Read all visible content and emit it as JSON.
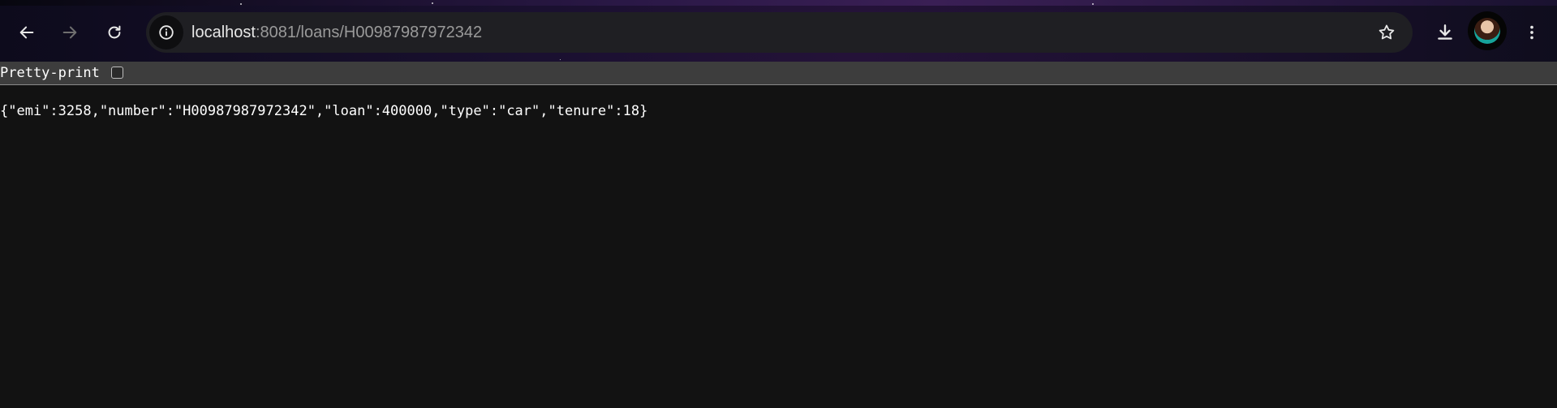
{
  "browser": {
    "url_host": "localhost",
    "url_path": ":8081/loans/H00987987972342"
  },
  "pretty_print": {
    "label": "Pretty-print",
    "checked": false
  },
  "response_body": "{\"emi\":3258,\"number\":\"H00987987972342\",\"loan\":400000,\"type\":\"car\",\"tenure\":18}",
  "icons": {
    "back": "arrow-left-icon",
    "forward": "arrow-right-icon",
    "reload": "reload-icon",
    "site_info": "info-icon",
    "bookmark": "star-outline-icon",
    "download": "download-icon",
    "menu": "kebab-menu-icon"
  },
  "colors": {
    "page_background": "#121212",
    "pretty_print_bar": "#3d3d3d",
    "omnibox": "#1f1f23",
    "text": "#ffffff"
  }
}
